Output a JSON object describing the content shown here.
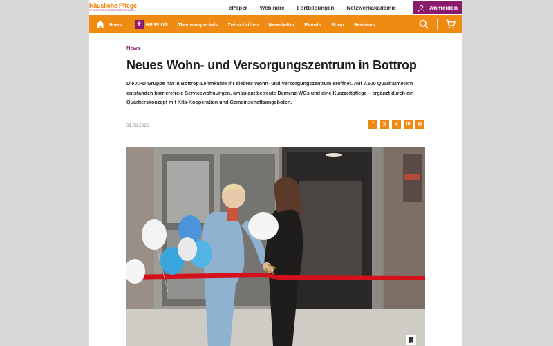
{
  "brand": {
    "name": "Häusliche Pflege",
    "tagline": "PFLEGEDIENSTE BESSER MANAGEN"
  },
  "header": {
    "links": [
      "ePaper",
      "Webinare",
      "Fortbildungen",
      "Netzwerkakademie"
    ],
    "login_label": "Anmelden"
  },
  "nav": {
    "items": [
      "News",
      "Themenspecials",
      "Zeitschriften",
      "Newsletter",
      "Events",
      "Shop",
      "Services"
    ],
    "hpplus_label": "HP PLUS",
    "hpplus_mark": "+"
  },
  "article": {
    "category": "News",
    "title": "Neues Wohn- und Versorgungszentrum in Bottrop",
    "lead": "Die APD Gruppe hat in Bottrop-Lehmkuhle ihr siebtes Wohn- und Versorgungszentrum eröffnet. Auf 7.500 Quadratmetern entstanden barrierefreie Servicewohnungen, ambulant betreute Demenz-WGs und eine Kurzzeitpflege – ergänzt durch ein Quartierskonzept mit Kita-Kooperation und Gemeinschaftsangeboten.",
    "date": "31.03.2026"
  },
  "share": {
    "icons": [
      "facebook-icon",
      "x-icon",
      "xing-icon",
      "linkedin-icon",
      "mail-icon"
    ],
    "labels": [
      "f",
      "𝕏",
      "✕",
      "in",
      "✉"
    ]
  },
  "colors": {
    "accent_orange": "#ef8a12",
    "brand_purple": "#8a1a6b"
  }
}
